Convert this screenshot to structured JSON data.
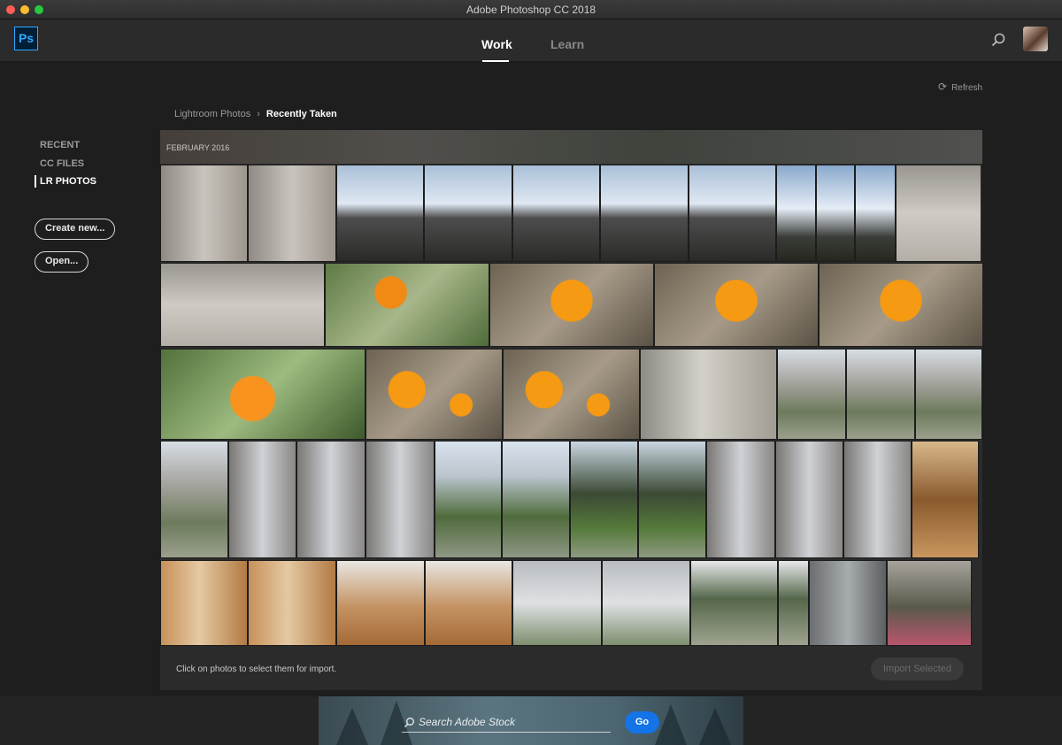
{
  "window": {
    "title": "Adobe Photoshop CC 2018"
  },
  "appbar": {
    "logo": "Ps",
    "tabs": [
      {
        "label": "Work",
        "active": true
      },
      {
        "label": "Learn",
        "active": false
      }
    ],
    "search_icon": "search-icon",
    "avatar": "user-avatar"
  },
  "refresh": {
    "label": "Refresh",
    "icon": "refresh-icon"
  },
  "sidebar": {
    "items": [
      {
        "label": "RECENT"
      },
      {
        "label": "CC FILES"
      },
      {
        "label": "LR PHOTOS",
        "active": true
      }
    ],
    "create_label": "Create new...",
    "open_label": "Open..."
  },
  "breadcrumb": {
    "root": "Lightroom Photos",
    "separator": "›",
    "current": "Recently Taken"
  },
  "gallery": {
    "month": "FEBRUARY 2016",
    "rows": [
      [
        "cathedral-window",
        "cathedral-window",
        "church-tree",
        "church-tree",
        "church-tree",
        "church-tree",
        "church-tree",
        "tree-sky",
        "tree-sky",
        "tree-sky",
        "stone-steps"
      ],
      [
        "stone-steps",
        "poppy-field",
        "poppy-closeup",
        "poppy-closeup",
        "poppy-closeup"
      ],
      [
        "poppy-grass",
        "poppy-pair",
        "poppy-pair",
        "stone-arch",
        "building-path",
        "building-path",
        "building-path"
      ],
      [
        "building-path",
        "leaded-window",
        "leaded-window",
        "leaded-window",
        "courtyard-path",
        "courtyard-path",
        "courtyard-tree",
        "courtyard-tree",
        "leaded-window",
        "leaded-window",
        "leaded-window",
        "open-doorway"
      ],
      [
        "wooden-doors",
        "wooden-doors",
        "arched-entry",
        "arched-entry",
        "window-flowers",
        "window-flowers",
        "tree-building",
        "tree-building",
        "building-facade",
        "gothic-arch"
      ]
    ]
  },
  "footer": {
    "message": "Click on photos to select them for import.",
    "import_label": "Import Selected"
  },
  "stock": {
    "placeholder": "Search Adobe Stock",
    "go_label": "Go"
  }
}
